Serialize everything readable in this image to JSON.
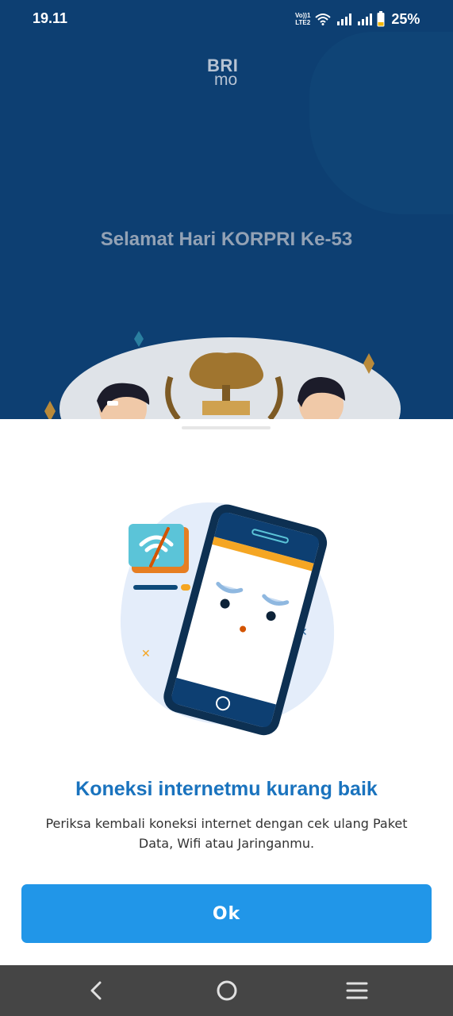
{
  "status_bar": {
    "time": "19.11",
    "network_label_top": "Vo))1",
    "network_label_bottom": "LTE2",
    "battery_percent": "25%"
  },
  "background": {
    "logo_top": "BRI",
    "logo_bottom": "mo",
    "banner_title": "Selamat Hari KORPRI Ke-53"
  },
  "dialog": {
    "title": "Koneksi internetmu kurang baik",
    "message": "Periksa kembali koneksi internet dengan cek ulang Paket Data, Wifi atau Jaringanmu.",
    "ok_label": "Ok"
  },
  "navigation": {
    "back_icon": "chevron-left-icon",
    "home_icon": "circle-home-icon",
    "menu_icon": "three-lines-menu-icon"
  },
  "colors": {
    "header_bg": "#0d3f72",
    "title_blue": "#1a73be",
    "button_blue": "#2196e8",
    "nav_bar": "#454545",
    "accent_orange": "#f5a623"
  }
}
